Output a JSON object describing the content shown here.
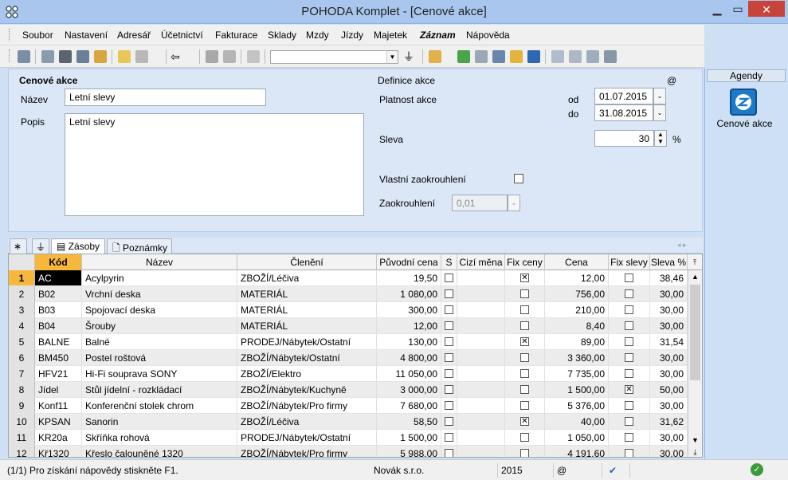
{
  "window": {
    "title": "POHODA Komplet - [Cenové akce]"
  },
  "menu": [
    "Soubor",
    "Nastavení",
    "Adresář",
    "Účetnictví",
    "Fakturace",
    "Sklady",
    "Mzdy",
    "Jízdy",
    "Majetek",
    "Záznam",
    "Nápověda"
  ],
  "form": {
    "section_title": "Cenové akce",
    "name_label": "Název",
    "name_value": "Letní slevy",
    "desc_label": "Popis",
    "desc_value": "Letní slevy",
    "definition_title": "Definice akce",
    "at_sign": "@",
    "validity_label": "Platnost akce",
    "from_label": "od",
    "from_value": "01.07.2015",
    "to_label": "do",
    "to_value": "31.08.2015",
    "discount_label": "Sleva",
    "discount_value": "30",
    "percent_sign": "%",
    "own_rounding_label": "Vlastní zaokrouhlení",
    "rounding_label": "Zaokrouhlení",
    "rounding_value": "0,01"
  },
  "tabs": {
    "star": "∗",
    "stocks": "Zásoby",
    "notes": "Poznámky"
  },
  "grid": {
    "columns": [
      "Kód",
      "Název",
      "Členění",
      "Původní cena",
      "S",
      "Cizí měna",
      "Fix ceny",
      "Cena",
      "Fix slevy",
      "Sleva %"
    ],
    "rows": [
      {
        "n": "1",
        "kod": "AC",
        "nazev": "Acylpyrin",
        "cleneni": "ZBOŽÍ/Léčiva",
        "puvodni": "19,50",
        "fixceny": true,
        "cena": "12,00",
        "fixslevy": false,
        "sleva": "38,46"
      },
      {
        "n": "2",
        "kod": "B02",
        "nazev": "Vrchní deska",
        "cleneni": "MATERIÁL",
        "puvodni": "1 080,00",
        "fixceny": false,
        "cena": "756,00",
        "fixslevy": false,
        "sleva": "30,00"
      },
      {
        "n": "3",
        "kod": "B03",
        "nazev": "Spojovací deska",
        "cleneni": "MATERIÁL",
        "puvodni": "300,00",
        "fixceny": false,
        "cena": "210,00",
        "fixslevy": false,
        "sleva": "30,00"
      },
      {
        "n": "4",
        "kod": "B04",
        "nazev": "Šrouby",
        "cleneni": "MATERIÁL",
        "puvodni": "12,00",
        "fixceny": false,
        "cena": "8,40",
        "fixslevy": false,
        "sleva": "30,00"
      },
      {
        "n": "5",
        "kod": "BALNE",
        "nazev": "Balné",
        "cleneni": "PRODEJ/Nábytek/Ostatní",
        "puvodni": "130,00",
        "fixceny": true,
        "cena": "89,00",
        "fixslevy": false,
        "sleva": "31,54"
      },
      {
        "n": "6",
        "kod": "BM450",
        "nazev": "Postel roštová",
        "cleneni": "ZBOŽÍ/Nábytek/Ostatní",
        "puvodni": "4 800,00",
        "fixceny": false,
        "cena": "3 360,00",
        "fixslevy": false,
        "sleva": "30,00"
      },
      {
        "n": "7",
        "kod": "HFV21",
        "nazev": "Hi-Fi souprava SONY",
        "cleneni": "ZBOŽÍ/Elektro",
        "puvodni": "11 050,00",
        "fixceny": false,
        "cena": "7 735,00",
        "fixslevy": false,
        "sleva": "30,00"
      },
      {
        "n": "8",
        "kod": "Jídel",
        "nazev": "Stůl jídelní - rozkládací",
        "cleneni": "ZBOŽÍ/Nábytek/Kuchyně",
        "puvodni": "3 000,00",
        "fixceny": false,
        "cena": "1 500,00",
        "fixslevy": true,
        "sleva": "50,00"
      },
      {
        "n": "9",
        "kod": "Konf11",
        "nazev": "Konferenční stolek chrom",
        "cleneni": "ZBOŽÍ/Nábytek/Pro firmy",
        "puvodni": "7 680,00",
        "fixceny": false,
        "cena": "5 376,00",
        "fixslevy": false,
        "sleva": "30,00"
      },
      {
        "n": "10",
        "kod": "KPSAN",
        "nazev": "Sanorin",
        "cleneni": "ZBOŽÍ/Léčiva",
        "puvodni": "58,50",
        "fixceny": true,
        "cena": "40,00",
        "fixslevy": false,
        "sleva": "31,62"
      },
      {
        "n": "11",
        "kod": "KR20a",
        "nazev": "Skříňka rohová",
        "cleneni": "PRODEJ/Nábytek/Ostatní",
        "puvodni": "1 500,00",
        "fixceny": false,
        "cena": "1 050,00",
        "fixslevy": false,
        "sleva": "30,00"
      },
      {
        "n": "12",
        "kod": "Kř1320",
        "nazev": "Křeslo čalouněné 1320",
        "cleneni": "ZBOŽÍ/Nábytek/Pro firmy",
        "puvodni": "5 988,00",
        "fixceny": false,
        "cena": "4 191,60",
        "fixslevy": false,
        "sleva": "30,00"
      }
    ]
  },
  "status": {
    "help": "(1/1) Pro získání nápovědy stiskněte F1.",
    "company": "Novák s.r.o.",
    "year": "2015",
    "at": "@"
  },
  "agenda": {
    "header": "Agendy",
    "item": "Cenové akce"
  }
}
